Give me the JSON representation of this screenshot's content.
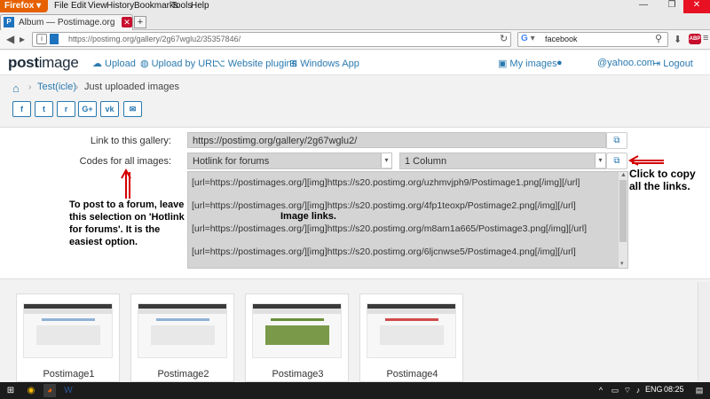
{
  "browser": {
    "button_label": "Firefox",
    "menus": [
      "File",
      "Edit",
      "View",
      "History",
      "Bookmarks",
      "Tools",
      "Help"
    ],
    "tab_title": "Album — Postimage.org",
    "url": "https://postimg.org/gallery/2g67wglu2/35357846/",
    "search_value": "facebook",
    "search_engine_letter": "G",
    "adblock_label": "ABP"
  },
  "site": {
    "logo_main": "post",
    "logo_tail": "image",
    "nav": {
      "upload": "Upload",
      "upload_by_url": "Upload by URL",
      "website_plugins": "Website plugins",
      "windows_app": "Windows App",
      "my_images": "My images",
      "email": "@yahoo.com",
      "logout": "Logout"
    }
  },
  "breadcrumb": {
    "gallery": "Test(icle)",
    "current": "Just uploaded images"
  },
  "share_buttons": [
    "f",
    "t",
    "r",
    "G+",
    "vk",
    "✉"
  ],
  "form": {
    "link_label": "Link to this gallery:",
    "link_value": "https://postimg.org/gallery/2g67wglu2/",
    "codes_label": "Codes for all images:",
    "format_value": "Hotlink for forums",
    "layout_value": "1 Column",
    "codes": [
      "[url=https://postimages.org/][img]https://s20.postimg.org/uzhmvjph9/Postimage1.png[/img][/url]",
      "[url=https://postimages.org/][img]https://s20.postimg.org/4fp1teoxp/Postimage2.png[/img][/url]",
      "[url=https://postimages.org/][img]https://s20.postimg.org/m8am1a665/Postimage3.png[/img][/url]",
      "[url=https://postimages.org/][img]https://s20.postimg.org/6ljcnwse5/Postimage4.png[/img][/url]"
    ]
  },
  "annotations": {
    "forum_tip": "To post to a forum, leave this selection on 'Hotlink for forums'. It is the easiest option.",
    "image_links": "Image links.",
    "copy_tip": "Click to copy all the links."
  },
  "thumbnails": [
    "Postimage1",
    "Postimage2",
    "Postimage3",
    "Postimage4"
  ],
  "taskbar": {
    "language": "ENG",
    "time": "08:25"
  },
  "colors": {
    "accent": "#2a7ab0",
    "annotation_red": "#d40000",
    "firefox_orange": "#e66000"
  }
}
